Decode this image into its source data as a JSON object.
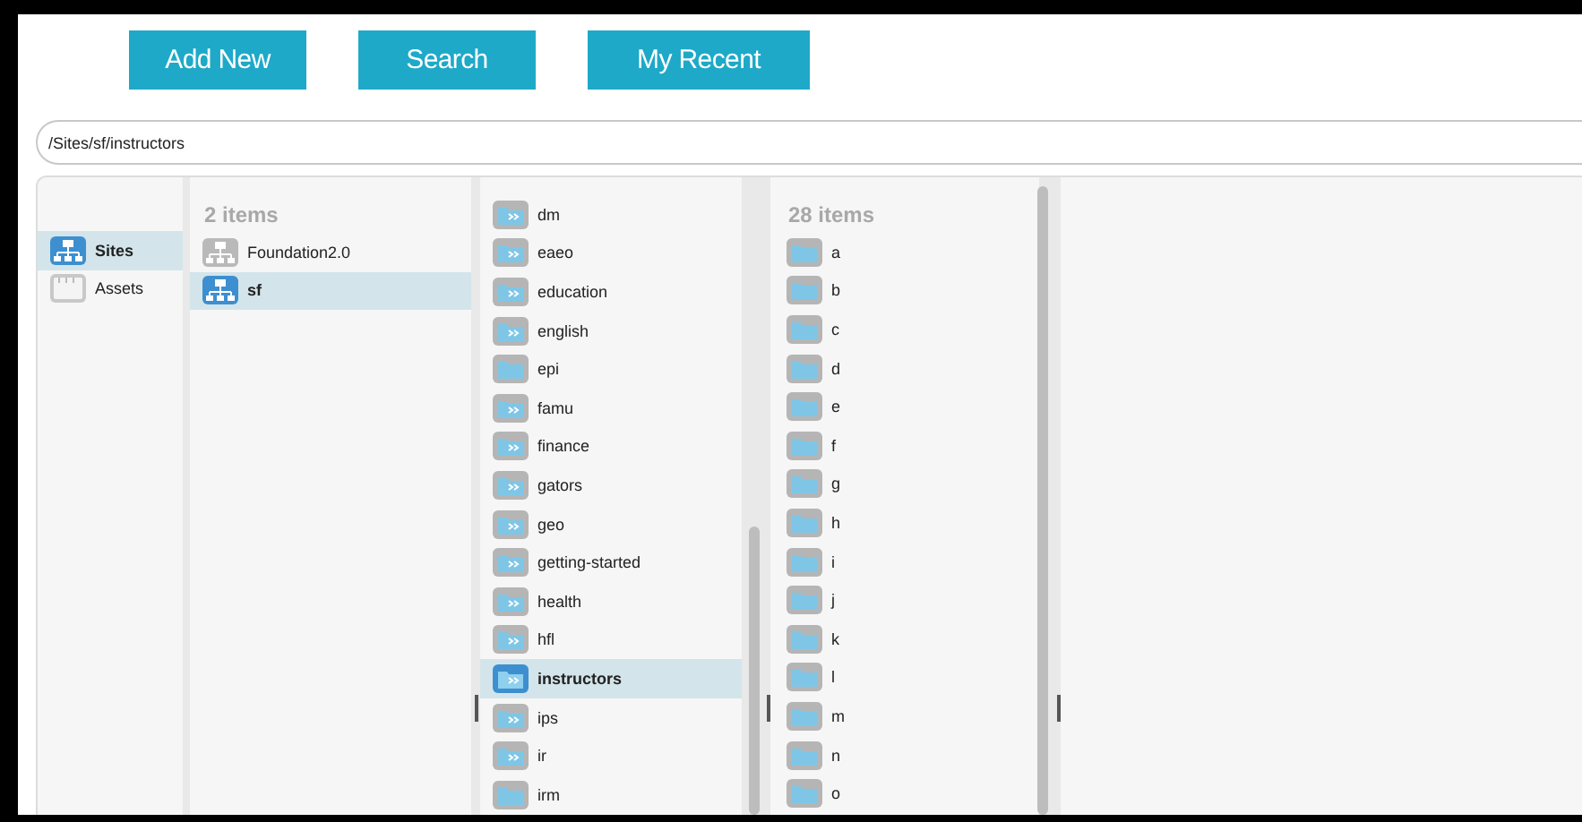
{
  "toolbar": [
    {
      "label": "Add New"
    },
    {
      "label": "Search"
    },
    {
      "label": "My Recent"
    }
  ],
  "path": {
    "value": "/Sites/sf/instructors"
  },
  "columns": [
    {
      "items": [
        {
          "label": "Sites",
          "kind": "sites",
          "selected": true
        },
        {
          "label": "Assets",
          "kind": "assets",
          "selected": false
        }
      ]
    },
    {
      "count": "2 items",
      "items": [
        {
          "label": "Foundation2.0",
          "kind": "site",
          "selected": false
        },
        {
          "label": "sf",
          "kind": "site",
          "selected": true
        }
      ]
    },
    {
      "items": [
        {
          "label": "dm",
          "kind": "linked",
          "selected": false
        },
        {
          "label": "eaeo",
          "kind": "linked",
          "selected": false
        },
        {
          "label": "education",
          "kind": "linked",
          "selected": false
        },
        {
          "label": "english",
          "kind": "linked",
          "selected": false
        },
        {
          "label": "epi",
          "kind": "folder",
          "selected": false
        },
        {
          "label": "famu",
          "kind": "linked",
          "selected": false
        },
        {
          "label": "finance",
          "kind": "linked",
          "selected": false
        },
        {
          "label": "gators",
          "kind": "linked",
          "selected": false
        },
        {
          "label": "geo",
          "kind": "linked",
          "selected": false
        },
        {
          "label": "getting-started",
          "kind": "linked",
          "selected": false
        },
        {
          "label": "health",
          "kind": "linked",
          "selected": false
        },
        {
          "label": "hfl",
          "kind": "linked",
          "selected": false
        },
        {
          "label": "instructors",
          "kind": "linked",
          "selected": true
        },
        {
          "label": "ips",
          "kind": "linked",
          "selected": false
        },
        {
          "label": "ir",
          "kind": "linked",
          "selected": false
        },
        {
          "label": "irm",
          "kind": "folder",
          "selected": false
        }
      ]
    },
    {
      "count": "28 items",
      "items": [
        {
          "label": "a",
          "kind": "folder",
          "selected": false
        },
        {
          "label": "b",
          "kind": "folder",
          "selected": false
        },
        {
          "label": "c",
          "kind": "folder",
          "selected": false
        },
        {
          "label": "d",
          "kind": "folder",
          "selected": false
        },
        {
          "label": "e",
          "kind": "folder",
          "selected": false
        },
        {
          "label": "f",
          "kind": "folder",
          "selected": false
        },
        {
          "label": "g",
          "kind": "folder",
          "selected": false
        },
        {
          "label": "h",
          "kind": "folder",
          "selected": false
        },
        {
          "label": "i",
          "kind": "folder",
          "selected": false
        },
        {
          "label": "j",
          "kind": "folder",
          "selected": false
        },
        {
          "label": "k",
          "kind": "folder",
          "selected": false
        },
        {
          "label": "l",
          "kind": "folder",
          "selected": false
        },
        {
          "label": "m",
          "kind": "folder",
          "selected": false
        },
        {
          "label": "n",
          "kind": "folder",
          "selected": false
        },
        {
          "label": "o",
          "kind": "folder",
          "selected": false
        }
      ]
    }
  ]
}
